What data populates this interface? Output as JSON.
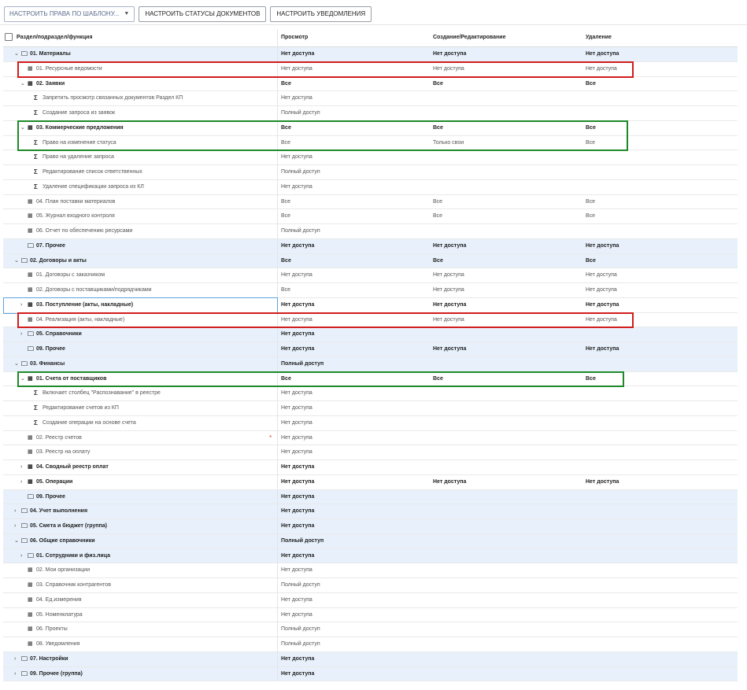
{
  "toolbar": {
    "template_select": "НАСТРОИТЬ ПРАВА ПО ШАБЛОНУ...",
    "statuses_button": "НАСТРОИТЬ СТАТУСЫ ДОКУМЕНТОВ",
    "notifications_button": "НАСТРОИТЬ УВЕДОМЛЕНИЯ"
  },
  "columns": {
    "section": "Раздел/подраздел/функция",
    "view": "Просмотр",
    "create_edit": "Создание/Редактирование",
    "delete": "Удаление"
  },
  "rows": [
    {
      "level": 0,
      "toggle": "down",
      "icon": "folder",
      "label": "01. Материалы",
      "view": "Нет доступа",
      "edit": "Нет доступа",
      "del": "Нет доступа",
      "style": "group"
    },
    {
      "level": 1,
      "toggle": "",
      "icon": "table",
      "label": "01. Ресурсные ведомости",
      "view": "Нет доступа",
      "edit": "Нет доступа",
      "del": "Нет доступа",
      "style": "item"
    },
    {
      "level": 1,
      "toggle": "down",
      "icon": "table",
      "label": "02. Заявки",
      "view": "Все",
      "edit": "Все",
      "del": "Все",
      "style": "item-bold"
    },
    {
      "level": 2,
      "toggle": "",
      "icon": "sigma",
      "label": "Запретить просмотр связанных документов Раздел КП",
      "view": "Нет доступа",
      "edit": "",
      "del": "",
      "style": "item"
    },
    {
      "level": 2,
      "toggle": "",
      "icon": "sigma",
      "label": "Создание запроса из заявок",
      "view": "Полный доступ",
      "edit": "",
      "del": "",
      "style": "item"
    },
    {
      "level": 1,
      "toggle": "down",
      "icon": "table",
      "label": "03. Коммерческие предложения",
      "view": "Все",
      "edit": "Все",
      "del": "Все",
      "style": "item-bold"
    },
    {
      "level": 2,
      "toggle": "",
      "icon": "sigma",
      "label": "Право на изменение статуса",
      "view": "Все",
      "edit": "Только свои",
      "del": "Все",
      "style": "item"
    },
    {
      "level": 2,
      "toggle": "",
      "icon": "sigma",
      "label": "Право на удаление запроса",
      "view": "Нет доступа",
      "edit": "",
      "del": "",
      "style": "item"
    },
    {
      "level": 2,
      "toggle": "",
      "icon": "sigma",
      "label": "Редактирование список ответственных",
      "view": "Полный доступ",
      "edit": "",
      "del": "",
      "style": "item"
    },
    {
      "level": 2,
      "toggle": "",
      "icon": "sigma",
      "label": "Удаление спецификации запроса из КЛ",
      "view": "Нет доступа",
      "edit": "",
      "del": "",
      "style": "item"
    },
    {
      "level": 1,
      "toggle": "",
      "icon": "table",
      "label": "04. План поставки материалов",
      "view": "Все",
      "edit": "Все",
      "del": "Все",
      "style": "item"
    },
    {
      "level": 1,
      "toggle": "",
      "icon": "table",
      "label": "05. Журнал входного контроля",
      "view": "Все",
      "edit": "Все",
      "del": "Все",
      "style": "item"
    },
    {
      "level": 1,
      "toggle": "",
      "icon": "table",
      "label": "06. Отчет по обеспечению ресурсами",
      "view": "Полный доступ",
      "edit": "",
      "del": "",
      "style": "item"
    },
    {
      "level": 1,
      "toggle": "",
      "icon": "folder",
      "label": "07. Прочее",
      "view": "Нет доступа",
      "edit": "Нет доступа",
      "del": "Нет доступа",
      "style": "group"
    },
    {
      "level": 0,
      "toggle": "down",
      "icon": "folder",
      "label": "02. Договоры и акты",
      "view": "Все",
      "edit": "Все",
      "del": "Все",
      "style": "group"
    },
    {
      "level": 1,
      "toggle": "",
      "icon": "table",
      "label": "01. Договоры с заказчиком",
      "view": "Нет доступа",
      "edit": "Нет доступа",
      "del": "Нет доступа",
      "style": "item"
    },
    {
      "level": 1,
      "toggle": "",
      "icon": "table",
      "label": "02. Договоры с поставщиками/подрядчиками",
      "view": "Все",
      "edit": "Нет доступа",
      "del": "Нет доступа",
      "style": "item"
    },
    {
      "level": 1,
      "toggle": "right",
      "icon": "table",
      "label": "03. Поступление (акты, накладные)",
      "view": "Нет доступа",
      "edit": "Нет доступа",
      "del": "Нет доступа",
      "style": "item-bold"
    },
    {
      "level": 1,
      "toggle": "",
      "icon": "table",
      "label": "04. Реализация (акты, накладные)",
      "view": "Нет доступа",
      "edit": "Нет доступа",
      "del": "Нет доступа",
      "style": "item"
    },
    {
      "level": 1,
      "toggle": "right",
      "icon": "folder",
      "label": "05. Справочники",
      "view": "Нет доступа",
      "edit": "",
      "del": "",
      "style": "group"
    },
    {
      "level": 1,
      "toggle": "",
      "icon": "folder",
      "label": "09. Прочее",
      "view": "Нет доступа",
      "edit": "Нет доступа",
      "del": "Нет доступа",
      "style": "group"
    },
    {
      "level": 0,
      "toggle": "down",
      "icon": "folder",
      "label": "03. Финансы",
      "view": "Полный доступ",
      "edit": "",
      "del": "",
      "style": "group"
    },
    {
      "level": 1,
      "toggle": "down",
      "icon": "table",
      "label": "01. Счета от поставщиков",
      "view": "Все",
      "edit": "Все",
      "del": "Все",
      "style": "item-bold"
    },
    {
      "level": 2,
      "toggle": "",
      "icon": "sigma",
      "label": "Включает столбец \"Распознавание\" в реестре",
      "view": "Нет доступа",
      "edit": "",
      "del": "",
      "style": "item"
    },
    {
      "level": 2,
      "toggle": "",
      "icon": "sigma",
      "label": "Редактирование счетов из КП",
      "view": "Нет доступа",
      "edit": "",
      "del": "",
      "style": "item"
    },
    {
      "level": 2,
      "toggle": "",
      "icon": "sigma",
      "label": "Создание операции на основе счета",
      "view": "Нет доступа",
      "edit": "",
      "del": "",
      "style": "item"
    },
    {
      "level": 1,
      "toggle": "",
      "icon": "table",
      "label": "02. Реестр счетов",
      "view": "Нет доступа",
      "edit": "",
      "del": "",
      "style": "item",
      "star": "*"
    },
    {
      "level": 1,
      "toggle": "",
      "icon": "table",
      "label": "03. Реестр на оплату",
      "view": "Нет доступа",
      "edit": "",
      "del": "",
      "style": "item"
    },
    {
      "level": 1,
      "toggle": "right",
      "icon": "table",
      "label": "04. Сводный реестр оплат",
      "view": "Нет доступа",
      "edit": "",
      "del": "",
      "style": "item-bold"
    },
    {
      "level": 1,
      "toggle": "right",
      "icon": "table",
      "label": "05. Операции",
      "view": "Нет доступа",
      "edit": "Нет доступа",
      "del": "Нет доступа",
      "style": "item-bold"
    },
    {
      "level": 1,
      "toggle": "",
      "icon": "folder",
      "label": "09. Прочее",
      "view": "Нет доступа",
      "edit": "",
      "del": "",
      "style": "group"
    },
    {
      "level": 0,
      "toggle": "right",
      "icon": "folder",
      "label": "04. Учет выполнения",
      "view": "Нет доступа",
      "edit": "",
      "del": "",
      "style": "group"
    },
    {
      "level": 0,
      "toggle": "right",
      "icon": "folder",
      "label": "05. Смета и бюджет (группа)",
      "view": "Нет доступа",
      "edit": "",
      "del": "",
      "style": "group"
    },
    {
      "level": 0,
      "toggle": "down",
      "icon": "folder",
      "label": "06. Общие справочники",
      "view": "Полный доступ",
      "edit": "",
      "del": "",
      "style": "group"
    },
    {
      "level": 1,
      "toggle": "right",
      "icon": "folder",
      "label": "01. Сотрудники и физ.лица",
      "view": "Нет доступа",
      "edit": "",
      "del": "",
      "style": "group"
    },
    {
      "level": 1,
      "toggle": "",
      "icon": "table",
      "label": "02. Мои организации",
      "view": "Нет доступа",
      "edit": "",
      "del": "",
      "style": "item"
    },
    {
      "level": 1,
      "toggle": "",
      "icon": "table",
      "label": "03. Справочник контрагентов",
      "view": "Полный доступ",
      "edit": "",
      "del": "",
      "style": "item"
    },
    {
      "level": 1,
      "toggle": "",
      "icon": "table",
      "label": "04. Ед.измерения",
      "view": "Нет доступа",
      "edit": "",
      "del": "",
      "style": "item"
    },
    {
      "level": 1,
      "toggle": "",
      "icon": "table",
      "label": "05. Номенклатура",
      "view": "Нет доступа",
      "edit": "",
      "del": "",
      "style": "item"
    },
    {
      "level": 1,
      "toggle": "",
      "icon": "table",
      "label": "06. Проекты",
      "view": "Полный доступ",
      "edit": "",
      "del": "",
      "style": "item"
    },
    {
      "level": 1,
      "toggle": "",
      "icon": "table",
      "label": "08. Уведомления",
      "view": "Полный доступ",
      "edit": "",
      "del": "",
      "style": "item"
    },
    {
      "level": 0,
      "toggle": "right",
      "icon": "folder",
      "label": "07. Настройки",
      "view": "Нет доступа",
      "edit": "",
      "del": "",
      "style": "group"
    },
    {
      "level": 0,
      "toggle": "right",
      "icon": "folder",
      "label": "09. Прочее (группа)",
      "view": "Нет доступа",
      "edit": "",
      "del": "",
      "style": "group"
    }
  ],
  "highlights": [
    {
      "color": "red",
      "from": 1,
      "to": 1
    },
    {
      "color": "green",
      "from": 5,
      "to": 6
    },
    {
      "color": "blue",
      "from": 17,
      "to": 17
    },
    {
      "color": "red",
      "from": 18,
      "to": 18
    },
    {
      "color": "green",
      "from": 22,
      "to": 22
    }
  ]
}
